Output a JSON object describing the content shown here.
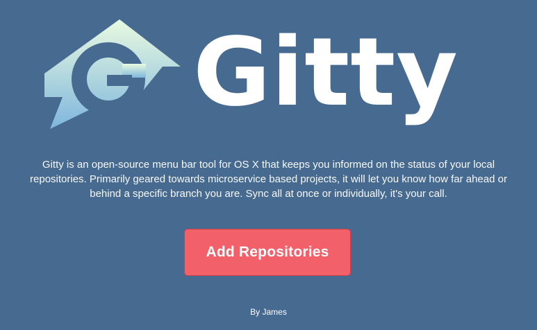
{
  "app": {
    "name": "Gitty",
    "logo_icon": "gitty-house-g-logo-icon"
  },
  "main": {
    "description": "Gitty is an open-source menu bar tool for OS X that keeps you informed on the status of your local repositories. Primarily geared towards microservice based projects, it will let you know how far ahead or behind a specific branch you are. Sync all at once or individually, it's your call.",
    "add_button_label": "Add Repositories"
  },
  "footer": {
    "credit": "By James"
  },
  "colors": {
    "background": "#476a90",
    "button": "#f2606a",
    "text": "#ffffff",
    "logo_gradient_top": "#e8fae0",
    "logo_gradient_bottom": "#7fb6dd"
  }
}
